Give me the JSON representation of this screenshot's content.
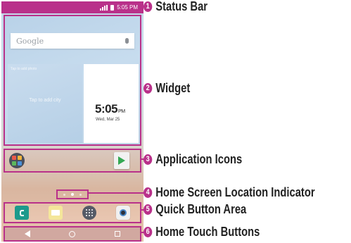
{
  "phone": {
    "status_time": "5:05 PM",
    "search_placeholder": "Google",
    "widget_photo_hint": "Tap to add photo",
    "widget_tap_text": "Tap to add city",
    "clock_time": "5:05",
    "clock_ampm": "PM",
    "clock_date": "Wed, Mar 25"
  },
  "callouts": [
    {
      "number": "1",
      "label": "Status Bar"
    },
    {
      "number": "2",
      "label": "Widget"
    },
    {
      "number": "3",
      "label": "Application Icons"
    },
    {
      "number": "4",
      "label": "Home Screen Location Indicator"
    },
    {
      "number": "5",
      "label": "Quick Button Area"
    },
    {
      "number": "6",
      "label": "Home Touch Buttons"
    }
  ],
  "icons": {
    "status": [
      "signal-icon",
      "battery-icon"
    ],
    "search": [
      "mic-icon"
    ],
    "apps": [
      "folder-icon",
      "play-store-icon"
    ],
    "quick": [
      "phone-icon",
      "messaging-icon",
      "apps-drawer-icon",
      "camera-icon"
    ],
    "nav": [
      "back-icon",
      "home-icon",
      "recent-apps-icon"
    ]
  },
  "colors": {
    "accent": "#b9318a"
  },
  "page_indicator": {
    "pages": 3,
    "active_index": 1
  }
}
